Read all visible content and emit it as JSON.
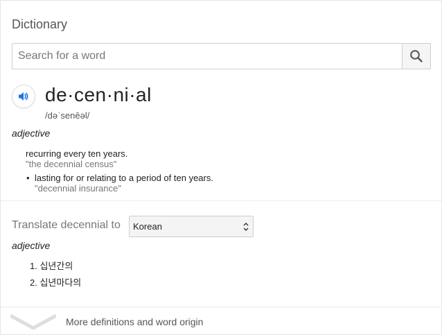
{
  "header": {
    "title": "Dictionary"
  },
  "search": {
    "placeholder": "Search for a word",
    "value": "",
    "icon": "search-icon"
  },
  "entry": {
    "headword": "de·cen·ni·al",
    "phonetic": "/dəˈsenēəl/",
    "part_of_speech": "adjective",
    "definitions": [
      {
        "text": "recurring every ten years.",
        "example": "\"the decennial census\""
      },
      {
        "text": "lasting for or relating to a period of ten years.",
        "example": "\"decennial insurance\""
      }
    ]
  },
  "translate": {
    "label": "Translate decennial to",
    "selected_language": "Korean",
    "part_of_speech": "adjective",
    "items": [
      "1. 십년간의",
      "2. 십년마다의"
    ]
  },
  "footer": {
    "more_label": "More definitions and word origin"
  },
  "colors": {
    "accent": "#1a73e8",
    "muted": "#767676"
  }
}
